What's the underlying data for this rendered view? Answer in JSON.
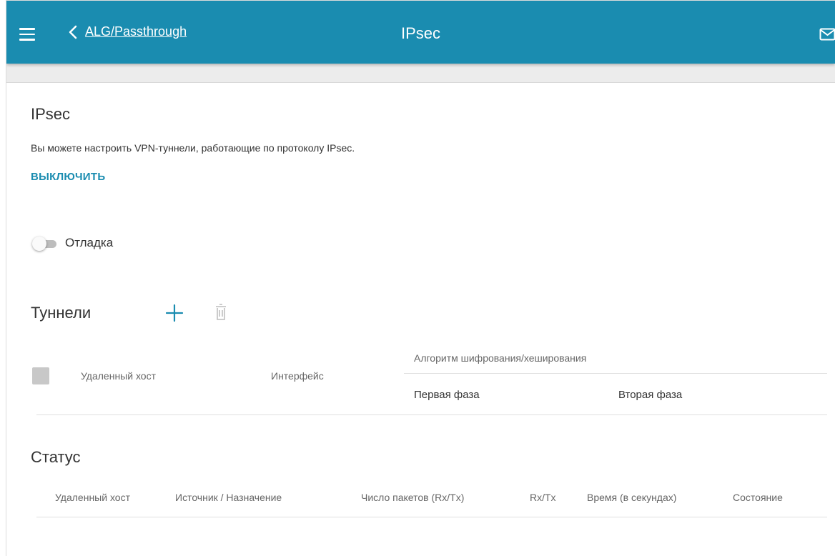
{
  "header": {
    "back_label": "ALG/Passthrough",
    "title": "IPsec",
    "bar_color": "#1a8cb0"
  },
  "section": {
    "title": "IPsec",
    "description": "Вы можете настроить VPN-туннели, работающие по протоколу IPsec.",
    "disable_label": "ВЫКЛЮЧИТЬ"
  },
  "debug": {
    "label": "Отладка",
    "enabled": false
  },
  "tunnels": {
    "title": "Туннели",
    "columns": {
      "remote_host": "Удаленный хост",
      "interface": "Интерфейс",
      "algorithm": "Алгоритм шифрования/хеширования",
      "phase1": "Первая фаза",
      "phase2": "Вторая фаза"
    }
  },
  "status": {
    "title": "Статус",
    "columns": [
      "Удаленный хост",
      "Источник / Назначение",
      "Число пакетов (Rx/Tx)",
      "Rx/Tx",
      "Время (в секундах)",
      "Состояние"
    ]
  },
  "icons": {
    "menu": "hamburger-menu-icon",
    "back": "chevron-left-icon",
    "notifications": "mail-icon",
    "add": "plus-icon",
    "delete": "trash-icon"
  }
}
